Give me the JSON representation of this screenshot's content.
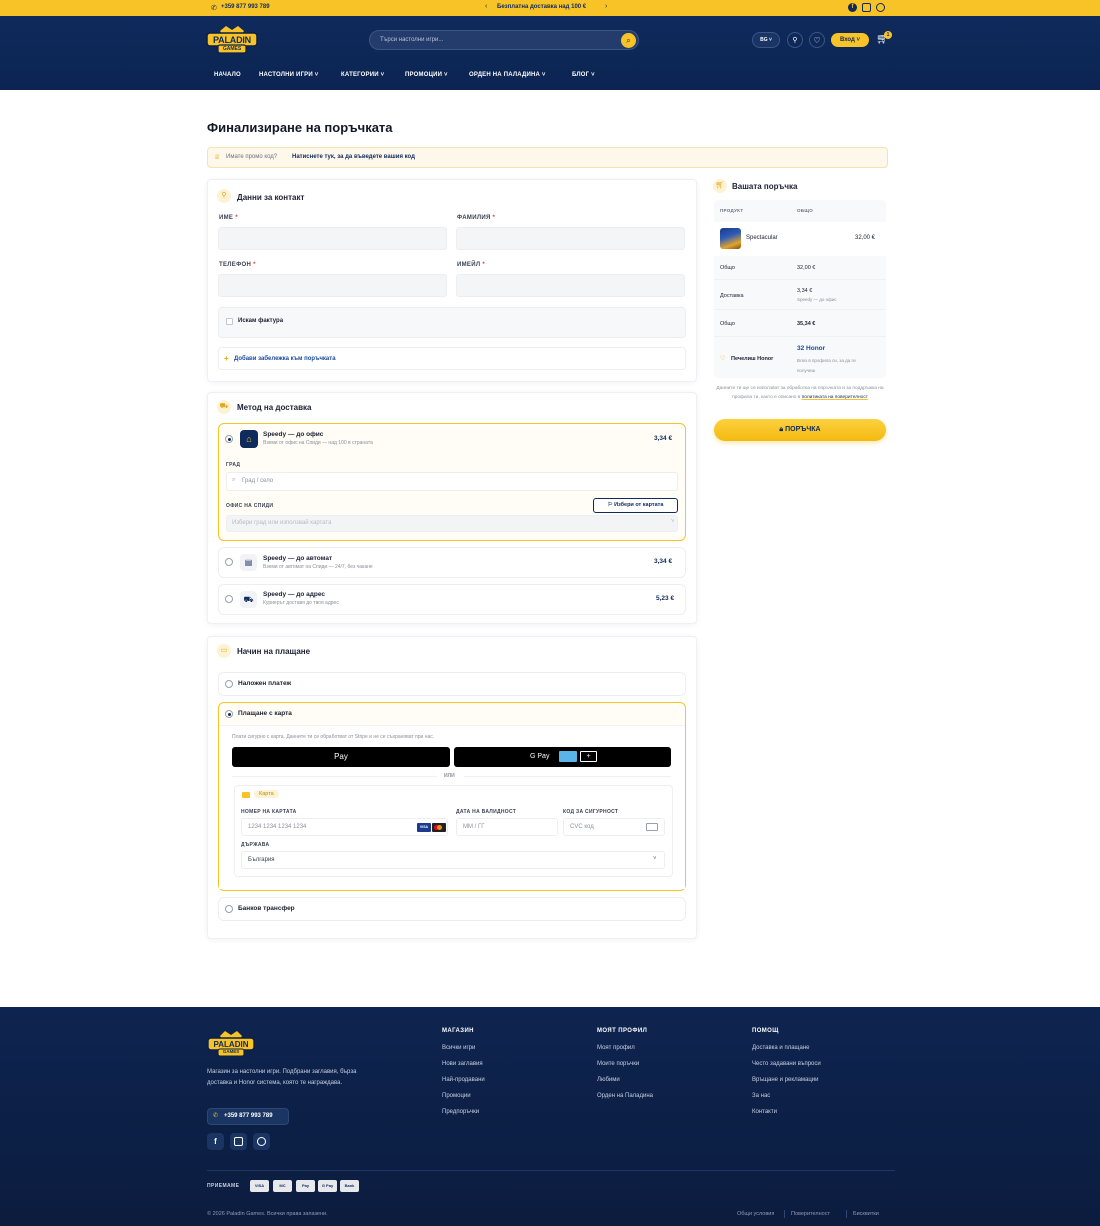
{
  "topbar": {
    "phone": "+359 877 993 789",
    "promo": "Безплатна доставка над 100 €"
  },
  "header": {
    "logo_top": "PALADIN",
    "logo_bottom": "GAMES",
    "search_placeholder": "Търси настолни игри...",
    "lang": "BG",
    "login": "Вход",
    "cart_count": "1"
  },
  "nav": [
    "НАЧАЛО",
    "НАСТОЛНИ ИГРИ",
    "КАТЕГОРИИ",
    "ПРОМОЦИИ",
    "ОРДЕН НА ПАЛАДИНА",
    "БЛОГ"
  ],
  "page": {
    "title": "Финализиране на поръчката",
    "promo_question": "Имате промо код?",
    "promo_link": "Натиснете тук, за да въведете вашия код"
  },
  "contact": {
    "title": "Данни за контакт",
    "first_name": "ИМЕ",
    "last_name": "ФАМИЛИЯ",
    "phone": "ТЕЛЕФОН",
    "email": "ИМЕЙЛ",
    "req": "*",
    "invoice": "Искам фактура",
    "note": "Добави забележка към поръчката"
  },
  "shipping": {
    "title": "Метод на доставка",
    "options": [
      {
        "name": "Speedy — до офис",
        "desc": "Вземи от офис на Спиди — над 100 в страната",
        "price": "3,34 €"
      },
      {
        "name": "Speedy — до автомат",
        "desc": "Вземи от автомат на Спиди — 24/7, без чакане",
        "price": "3,34 €"
      },
      {
        "name": "Speedy — до адрес",
        "desc": "Куриерът доставя до твоя адрес",
        "price": "5,23 €"
      }
    ],
    "city_label": "ГРАД",
    "city_placeholder": "Град / село",
    "office_label": "ОФИС НА СПИДИ",
    "office_placeholder": "Избери град или използвай картата",
    "map_button": "Избери от картата"
  },
  "payment": {
    "title": "Начин на плащане",
    "cod": "Наложен платеж",
    "card": "Плащане с карта",
    "card_note": "Плати сигурно с карта. Данните ти се обработват от Stripe и не се съхраняват при нас.",
    "apple_pay": "Pay",
    "google_pay": "G Pay",
    "or": "ИЛИ",
    "card_tab": "Карта",
    "card_number_label": "НОМЕР НА КАРТАТА",
    "card_number_placeholder": "1234 1234 1234 1234",
    "expiry_label": "ДАТА НА ВАЛИДНОСТ",
    "expiry_placeholder": "ММ / ГГ",
    "cvc_label": "КОД ЗА СИГУРНОСТ",
    "cvc_placeholder": "CVC код",
    "country_label": "ДЪРЖАВА",
    "country": "България",
    "bank": "Банков трансфер"
  },
  "order": {
    "title": "Вашата поръчка",
    "col_product": "ПРОДУКТ",
    "col_total": "ОБЩО",
    "product_name": "Spectacular",
    "product_price": "32,00 €",
    "subtotal_label": "Общо",
    "subtotal": "32,00 €",
    "shipping_label": "Доставка",
    "shipping": "3,34 €",
    "shipping_note": "Speedy — до офис",
    "total_label": "Общо",
    "total": "35,34 €",
    "honor_label": "Печелиш Honor",
    "honor_value": "32 Honor",
    "honor_note": "Влез в профила си, за да ги получиш",
    "privacy": "Данните ти ще се използват за обработка на поръчката и за поддръжка на профила ти, както е описано в",
    "privacy_link": "политиката на поверителност",
    "submit": "ПОРЪЧКА"
  },
  "footer": {
    "about": "Магазин за настолни игри. Подбрани заглавия, бърза доставка и Honor система, която те награждава.",
    "phone": "+359 877 993 789",
    "cols": [
      {
        "title": "МАГАЗИН",
        "links": [
          "Всички игри",
          "Нови заглавия",
          "Най-продавани",
          "Промоции",
          "Предпоръчки"
        ]
      },
      {
        "title": "МОЯТ ПРОФИЛ",
        "links": [
          "Моят профил",
          "Моите поръчки",
          "Любими",
          "Орден на Паладина"
        ]
      },
      {
        "title": "ПОМОЩ",
        "links": [
          "Доставка и плащане",
          "Често задавани въпроси",
          "Връщане и рекламации",
          "За нас",
          "Контакти"
        ]
      }
    ],
    "accept": "ПРИЕМАМЕ",
    "pay_icons": [
      "VISA",
      "MC",
      "Pay",
      "G Pay",
      "Bank"
    ],
    "copyright": "© 2026 Paladin Games. Всички права запазени.",
    "legal": [
      "Общи условия",
      "Поверителност",
      "Бисквитки"
    ]
  },
  "colors": {
    "navy": "#0f2a5c",
    "gold": "#f7c326",
    "footer": "#0c1d40"
  }
}
